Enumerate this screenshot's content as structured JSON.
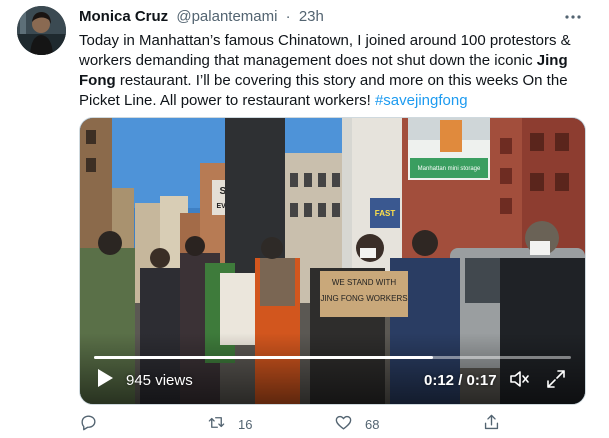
{
  "tweet": {
    "author_name": "Monica Cruz",
    "author_handle": "@palantemami",
    "separator": "·",
    "time": "23h",
    "text_before_bold": "Today in Manhattan’s famous Chinatown, I joined around 100 protestors & workers demanding that management does not shut down the iconic ",
    "text_bold": "Jing Fong",
    "text_after_bold": " restaurant. I’ll be covering this story and more on this weeks On the Picket Line. All power to restaurant workers! ",
    "hashtag": "#savejingfong"
  },
  "video": {
    "views": "945 views",
    "timecode": "0:12 / 0:17",
    "progress_fraction": 0.71,
    "signs": {
      "stop_sign": "STOP",
      "stop_sign_line2": "EVICTION",
      "held_sign_line1": "WE STAND WITH",
      "held_sign_line2": "JING FONG WORKERS",
      "store_sign": "Manhattan mini storage",
      "truck_sign": "FAST"
    }
  },
  "actions": {
    "reply_count": "",
    "retweet_count": "16",
    "like_count": "68"
  },
  "icons": {
    "more": "more-options-icon",
    "play": "play-icon",
    "volume": "volume-icon",
    "fullscreen": "fullscreen-icon",
    "reply": "reply-icon",
    "retweet": "retweet-icon",
    "like": "like-icon",
    "share": "share-icon"
  },
  "colors": {
    "accent": "#1d9bf0",
    "secondary_text": "#536471",
    "primary_text": "#0f1419"
  }
}
